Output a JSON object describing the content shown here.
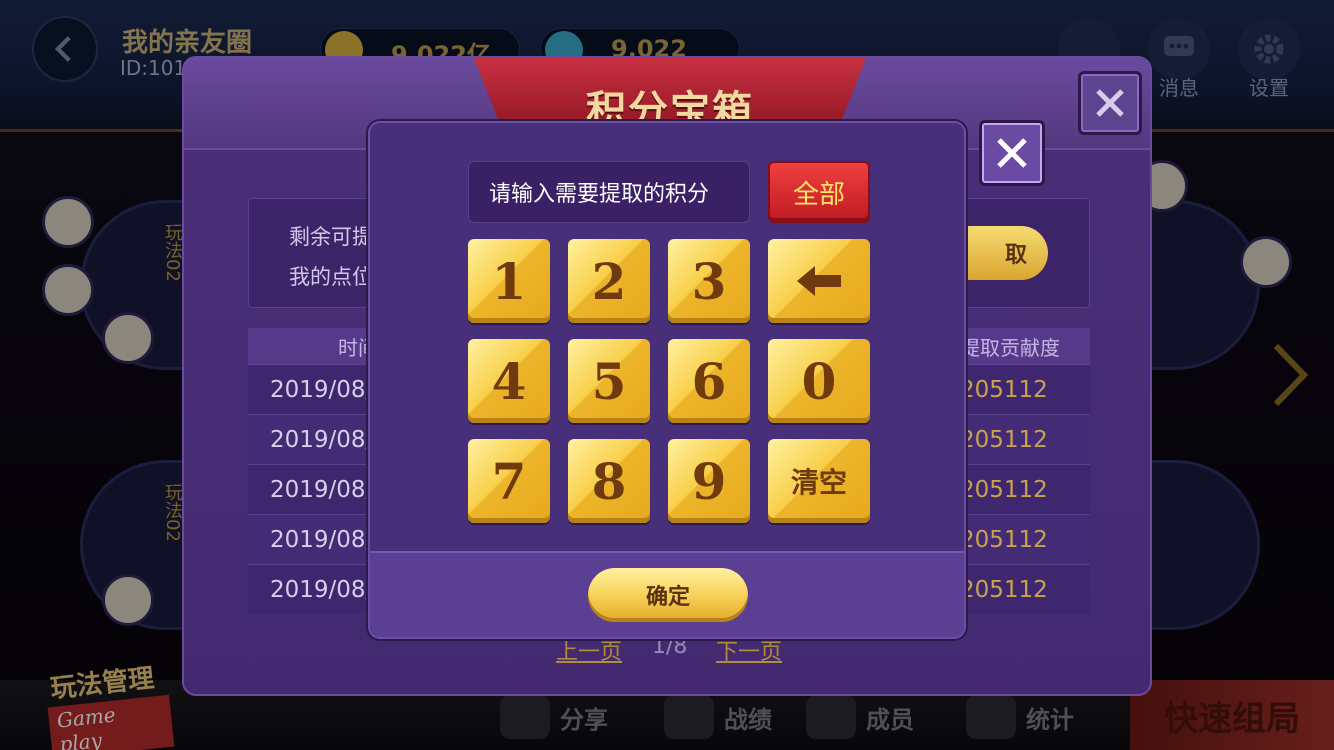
{
  "topbar": {
    "club_name": "我的亲友圈",
    "club_id": "ID:101",
    "gold_amount": "9,022亿",
    "diamond_amount": "9,022",
    "message_label": "消息",
    "settings_label": "设置"
  },
  "tables": {
    "table1_label": "玩法02",
    "table2_label": "玩法02"
  },
  "bottombar": {
    "gameplay_title": "玩法管理",
    "gameplay_sub": "Game play",
    "share": "分享",
    "record": "战绩",
    "members": "成员",
    "stats": "统计",
    "quick_start": "快速组局"
  },
  "dialog": {
    "title": "积分宝箱",
    "remaining_label": "剩余可提",
    "my_position_label": "我的点位",
    "extract_button": "取",
    "columns": [
      "时间",
      "提取贡献度"
    ],
    "rows": [
      {
        "time": "2019/08/2",
        "value": "205112"
      },
      {
        "time": "2019/08/2",
        "value": "205112"
      },
      {
        "time": "2019/08/2",
        "value": "205112"
      },
      {
        "time": "2019/08/2",
        "value": "205112"
      },
      {
        "time": "2019/08/2",
        "value": "205112"
      }
    ],
    "prev_page": "上一页",
    "page_indicator": "1/8",
    "next_page": "下一页"
  },
  "keypad": {
    "input_placeholder": "请输入需要提取的积分",
    "all_button": "全部",
    "keys": [
      "1",
      "2",
      "3",
      "4",
      "5",
      "6",
      "0",
      "7",
      "8",
      "9"
    ],
    "backspace_icon": "left-arrow-icon",
    "clear_button": "清空",
    "confirm_button": "确定"
  },
  "colors": {
    "dialog_purple": "#472f7a",
    "key_gold": "#f8cf4a",
    "key_text": "#6e3a0e",
    "all_button_red": "#d62a30",
    "all_button_text": "#ffe66a"
  }
}
